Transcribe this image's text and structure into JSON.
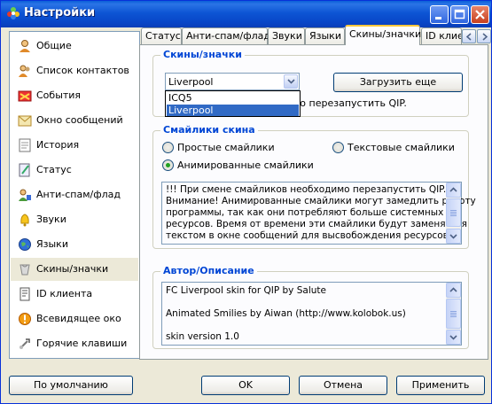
{
  "window": {
    "title": "Настройки"
  },
  "sidebar": {
    "items": [
      {
        "label": "Общие",
        "icon": "user-icon"
      },
      {
        "label": "Список контактов",
        "icon": "contacts-icon"
      },
      {
        "label": "События",
        "icon": "events-icon"
      },
      {
        "label": "Окно сообщений",
        "icon": "message-window-icon"
      },
      {
        "label": "История",
        "icon": "history-icon"
      },
      {
        "label": "Статус",
        "icon": "status-icon"
      },
      {
        "label": "Анти-спам/флад",
        "icon": "antispam-icon"
      },
      {
        "label": "Звуки",
        "icon": "sounds-icon"
      },
      {
        "label": "Языки",
        "icon": "globe-icon"
      },
      {
        "label": "Скины/значки",
        "icon": "skins-icon"
      },
      {
        "label": "ID клиента",
        "icon": "client-id-icon"
      },
      {
        "label": "Всевидящее око",
        "icon": "all-seeing-eye-icon"
      },
      {
        "label": "Горячие клавиши",
        "icon": "hotkeys-icon"
      }
    ],
    "selected": "Скины/значки"
  },
  "tabs": [
    "Статус",
    "Анти-спам/флад",
    "Звуки",
    "Языки",
    "Скины/значки",
    "ID клие"
  ],
  "active_tab": "Скины/значки",
  "skins": {
    "group_title": "Скины/значки",
    "combo_value": "Liverpool",
    "dropdown_options": [
      "ICQ5",
      "Liverpool"
    ],
    "load_button": "Загрузить еще",
    "restart_note": "мо перезапустить QIP."
  },
  "smilies": {
    "group_title": "Смайлики скина",
    "radio_simple": "Простые смайлики",
    "radio_text": "Текстовые смайлики",
    "radio_animated": "Анимированные смайлики",
    "selected": "Анимированные смайлики",
    "info_lines": [
      "!!! При смене смайликов необходимо перезапустить QIP.",
      "Внимание! Анимированные смайлики могут замедлить работу",
      "программы, так как они потребляют больше системных",
      "ресурсов. Время от времени эти смайлики будут заменяться",
      "текстом в окне сообщений для высвобождения ресурсов"
    ]
  },
  "author": {
    "group_title": "Автор/Описание",
    "lines": [
      "FC Liverpool skin for QIP by Salute",
      "",
      "Animated Smilies by Aiwan (http://www.kolobok.us)",
      "",
      "skin version 1.0"
    ]
  },
  "footer": {
    "default_button": "По умолчанию",
    "ok_button": "OK",
    "cancel_button": "Отмена",
    "apply_button": "Применить"
  },
  "colors": {
    "accent": "#0046d5",
    "titlebar": "#0a52d4",
    "selection": "#316ac5"
  }
}
